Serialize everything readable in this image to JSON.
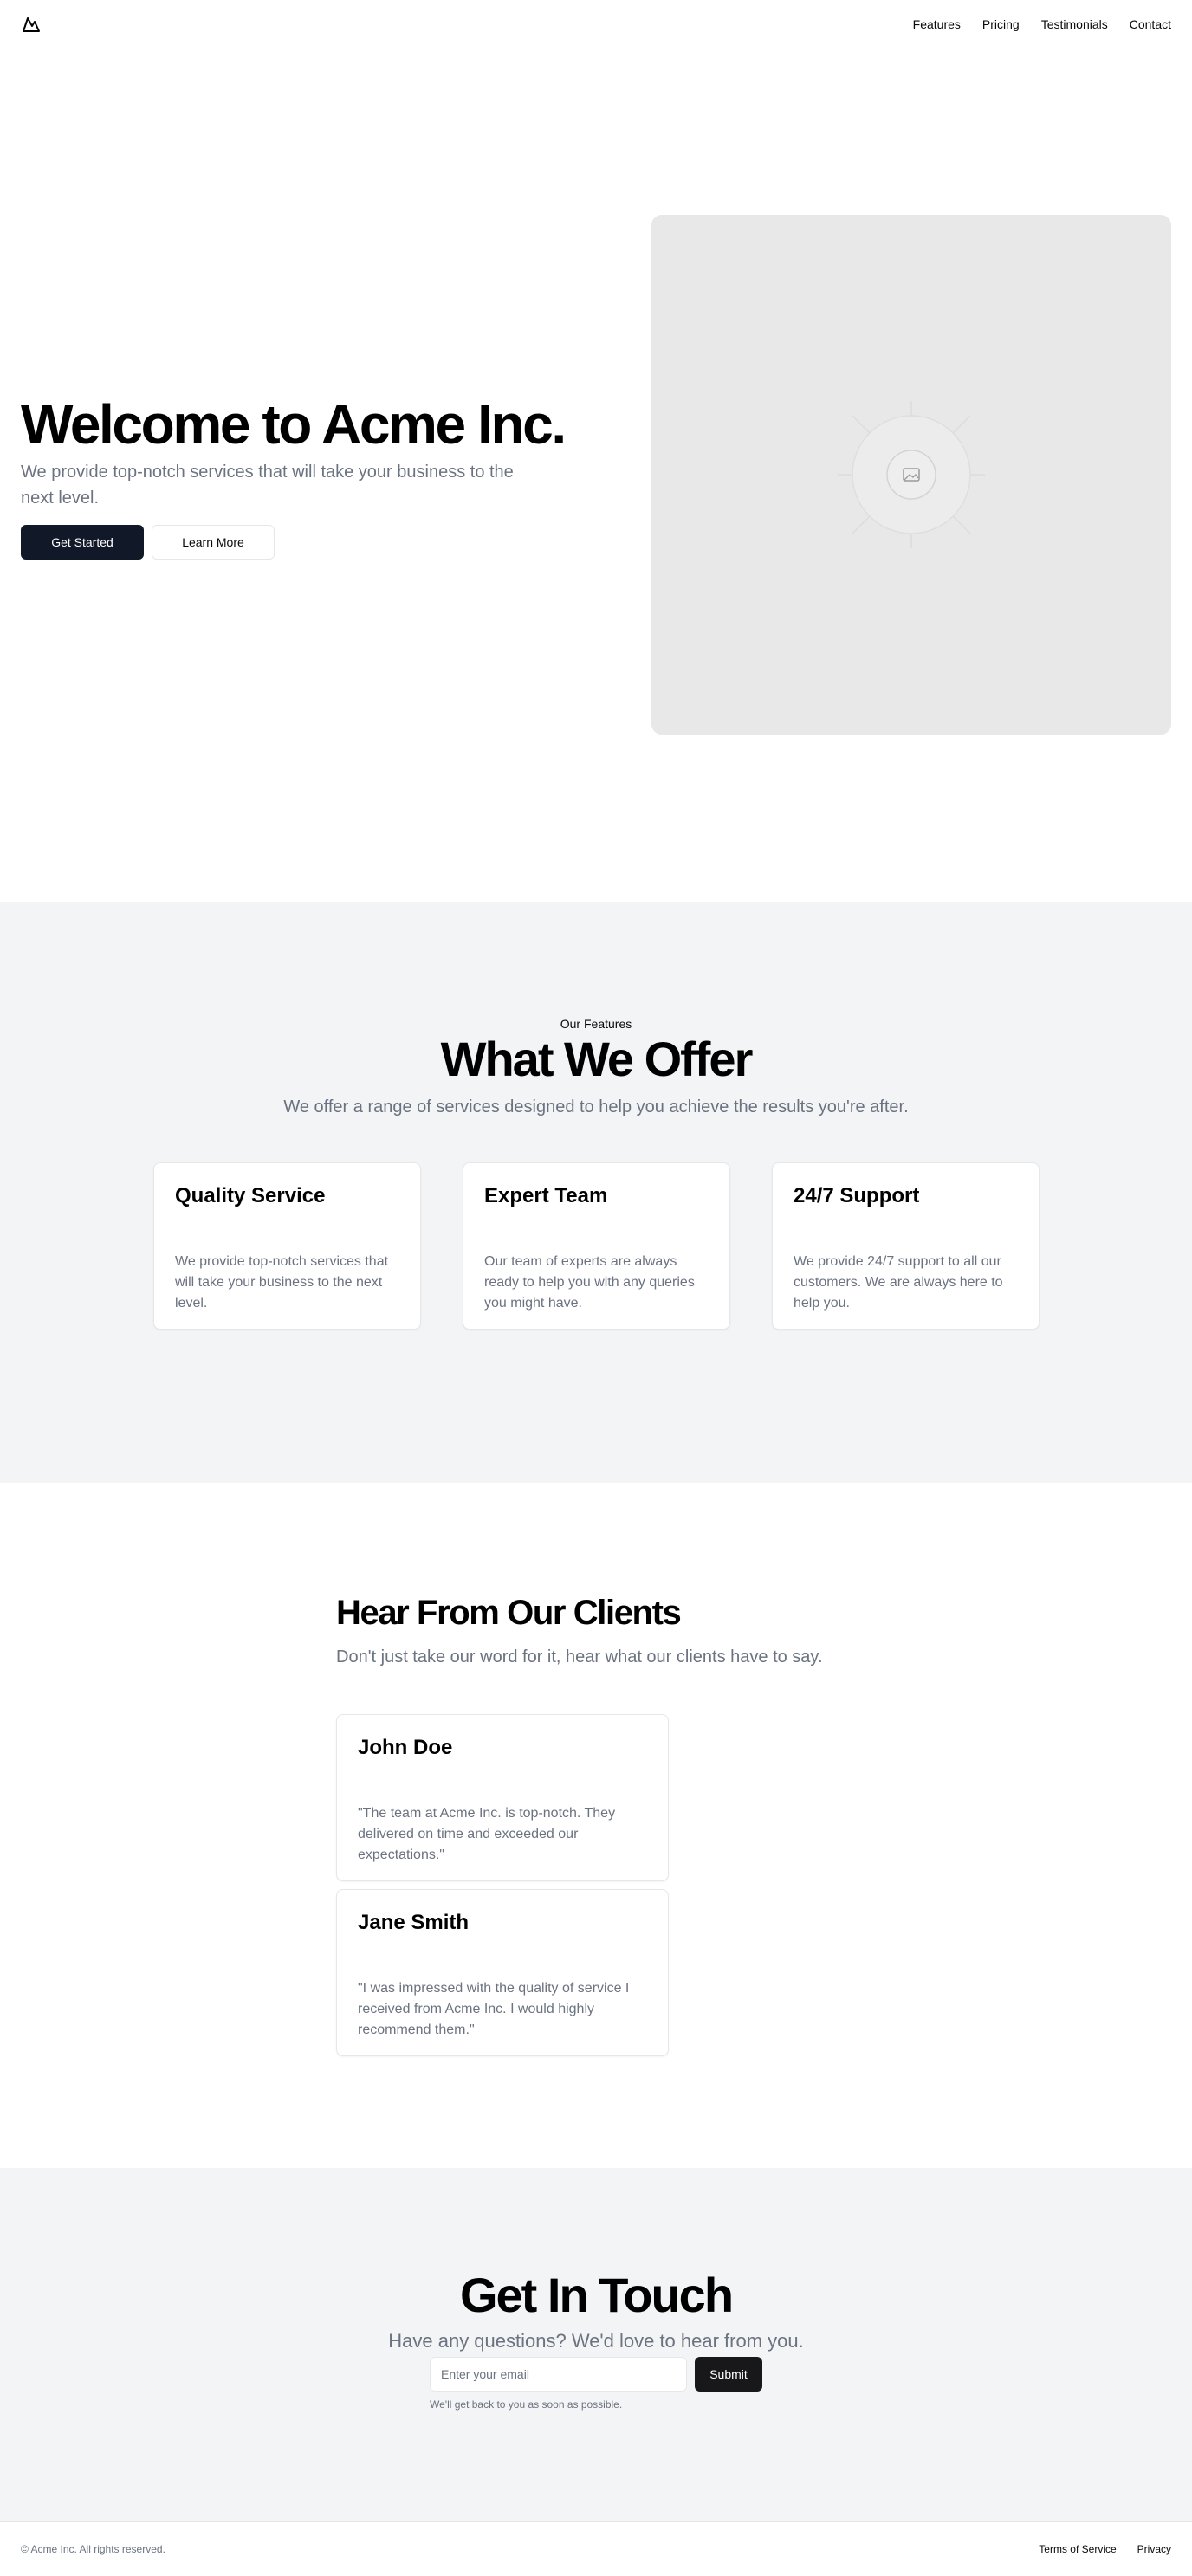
{
  "header": {
    "logo_icon": "mountain-icon",
    "nav": [
      {
        "label": "Features"
      },
      {
        "label": "Pricing"
      },
      {
        "label": "Testimonials"
      },
      {
        "label": "Contact"
      }
    ]
  },
  "hero": {
    "title": "Welcome to Acme Inc.",
    "subtitle": "We provide top-notch services that will take your business to the next level.",
    "primary_button": "Get Started",
    "secondary_button": "Learn More",
    "image_icon": "image-placeholder-icon"
  },
  "features": {
    "eyebrow": "Our Features",
    "title": "What We Offer",
    "subtitle": "We offer a range of services designed to help you achieve the results you're after.",
    "cards": [
      {
        "title": "Quality Service",
        "text": "We provide top-notch services that will take your business to the next level."
      },
      {
        "title": "Expert Team",
        "text": "Our team of experts are always ready to help you with any queries you might have."
      },
      {
        "title": "24/7 Support",
        "text": "We provide 24/7 support to all our customers. We are always here to help you."
      }
    ]
  },
  "testimonials": {
    "title": "Hear From Our Clients",
    "subtitle": "Don't just take our word for it, hear what our clients have to say.",
    "items": [
      {
        "name": "John Doe",
        "quote": "\"The team at Acme Inc. is top-notch. They delivered on time and exceeded our expectations.\""
      },
      {
        "name": "Jane Smith",
        "quote": "\"I was impressed with the quality of service I received from Acme Inc. I would highly recommend them.\""
      }
    ]
  },
  "contact": {
    "title": "Get In Touch",
    "subtitle": "Have any questions? We'd love to hear from you.",
    "email_placeholder": "Enter your email",
    "submit_label": "Submit",
    "note": "We'll get back to you as soon as possible."
  },
  "footer": {
    "copyright": "© Acme Inc. All rights reserved.",
    "links": [
      {
        "label": "Terms of Service"
      },
      {
        "label": "Privacy"
      }
    ]
  },
  "colors": {
    "primary": "#111827",
    "muted_text": "#6b7280",
    "section_bg": "#f3f4f6",
    "border": "#e5e7eb",
    "placeholder_bg": "#e8e8e8"
  }
}
